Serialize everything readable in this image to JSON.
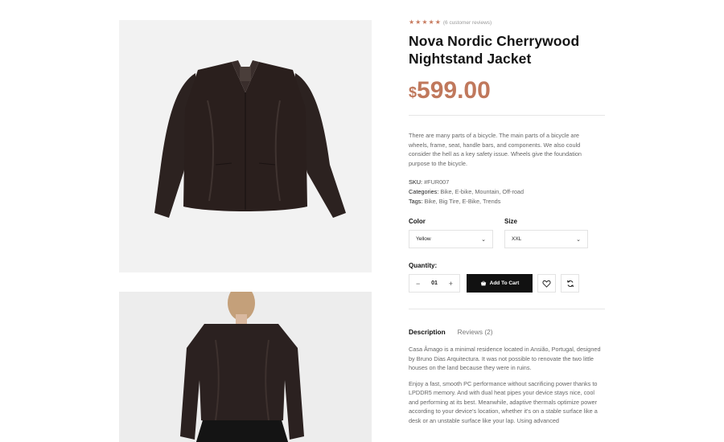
{
  "gallery": {
    "images": [
      "leather-jacket-front",
      "leather-jacket-back-model"
    ]
  },
  "product": {
    "rating": 5,
    "reviews_text": "(6 customer reviews)",
    "title": "Nova Nordic Cherrywood Nightstand Jacket",
    "price_currency": "$",
    "price_amount": "599.00",
    "description": "There are many parts of a bicycle. The main parts of a bicycle are wheels, frame, seat, handle bars, and components. We also could consider the hell as a key safety issue. Wheels give the foundation purpose to the bicycle.",
    "sku_label": "SKU:",
    "sku_value": "#FUR007",
    "categories_label": "Categories:",
    "categories_value": "Bike, E-bike, Mountain, Off-road",
    "tags_label": "Tags:",
    "tags_value": "Bike, Big Tire, E-Bike, Trends"
  },
  "options": {
    "color_label": "Color",
    "color_value": "Yellow",
    "size_label": "Size",
    "size_value": "XXL"
  },
  "purchase": {
    "quantity_label": "Quantity:",
    "quantity_value": "01",
    "add_to_cart_label": "Add To Cart"
  },
  "tabs": {
    "description_label": "Description",
    "reviews_label": "Reviews (2)"
  },
  "tab_content": {
    "p1": "Casa Âmago is a minimal residence located in Ansião, Portugal, designed by Bruno Dias Arquitectura. It was not possible to renovate the two little houses on the land because they were in ruins.",
    "p2": "Enjoy a fast, smooth PC performance without sacrificing power thanks to LPDDR5 memory. And with dual heat pipes your device stays nice, cool and performing at its best. Meanwhile, adaptive thermals optimize power according to your device's location, whether it's on a stable surface like a desk or an unstable surface like your lap. Using advanced"
  },
  "colors": {
    "accent": "#c0785c",
    "star": "#c77a5e",
    "button_bg": "#111111"
  }
}
